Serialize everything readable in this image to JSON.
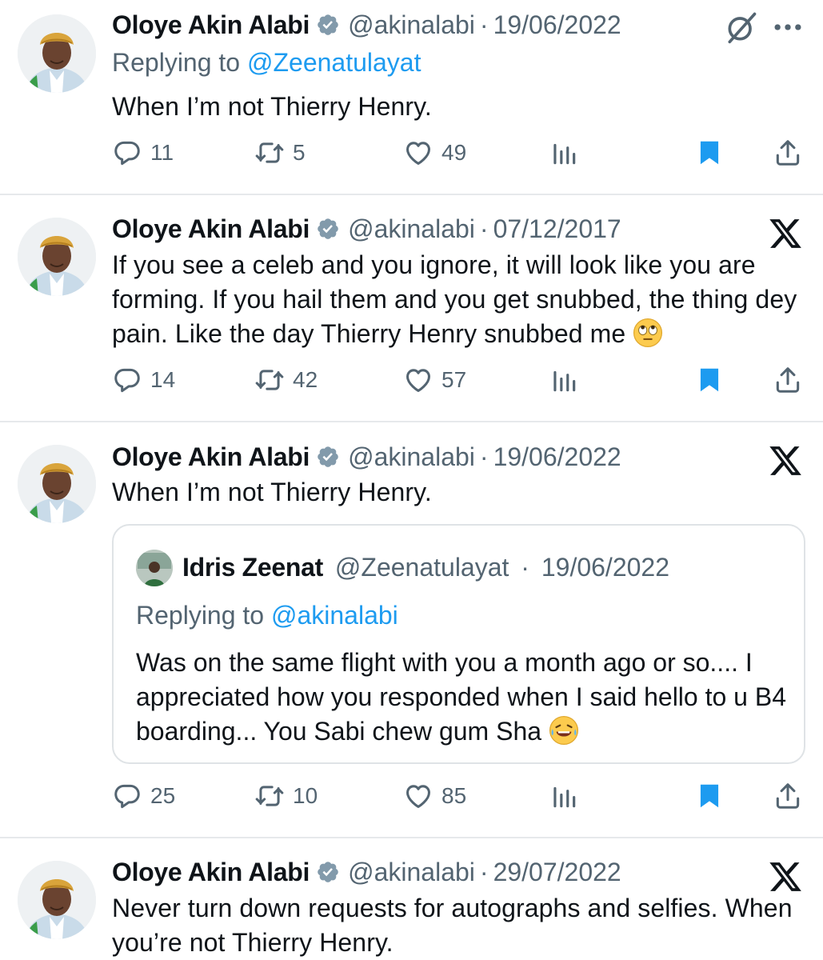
{
  "colors": {
    "accent": "#1d9bf0",
    "muted": "#536471",
    "text": "#0f1419",
    "divider": "#e6e9eb"
  },
  "tweets": [
    {
      "name": "Oloye Akin Alabi",
      "handle": "@akinalabi",
      "sep": "·",
      "date": "19/06/2022",
      "reply_prefix": "Replying to ",
      "reply_to": "@Zeenatulayat",
      "text": "When I’m not Thierry Henry.",
      "replies": "11",
      "retweets": "5",
      "likes": "49",
      "corner_icons": [
        "grok-icon",
        "more-icon"
      ]
    },
    {
      "name": "Oloye Akin Alabi",
      "handle": "@akinalabi",
      "sep": "·",
      "date": "07/12/2017",
      "text": "If you see a celeb and you ignore, it will look like you are forming. If you hail them and you get snubbed, the thing dey pain. Like the day Thierry Henry snubbed me",
      "emoji": "eye-roll-emoji",
      "replies": "14",
      "retweets": "42",
      "likes": "57",
      "corner_icons": [
        "x-logo-icon"
      ]
    },
    {
      "name": "Oloye Akin Alabi",
      "handle": "@akinalabi",
      "sep": "·",
      "date": "19/06/2022",
      "text": "When I’m not Thierry Henry.",
      "quote": {
        "name": "Idris Zeenat",
        "handle": "@Zeenatulayat",
        "sep": "·",
        "date": "19/06/2022",
        "reply_prefix": "Replying to ",
        "reply_to": "@akinalabi",
        "text": "Was on the same flight with you a month ago or so.... I appreciated how you responded when I said hello to u B4 boarding... You Sabi chew gum Sha",
        "emoji": "laughing-tears-emoji"
      },
      "replies": "25",
      "retweets": "10",
      "likes": "85",
      "corner_icons": [
        "x-logo-icon"
      ]
    },
    {
      "name": "Oloye Akin Alabi",
      "handle": "@akinalabi",
      "sep": "·",
      "date": "29/07/2022",
      "text": "Never turn down requests for autographs and selfies. When you’re not Thierry Henry.",
      "corner_icons": [
        "x-logo-icon"
      ]
    }
  ]
}
